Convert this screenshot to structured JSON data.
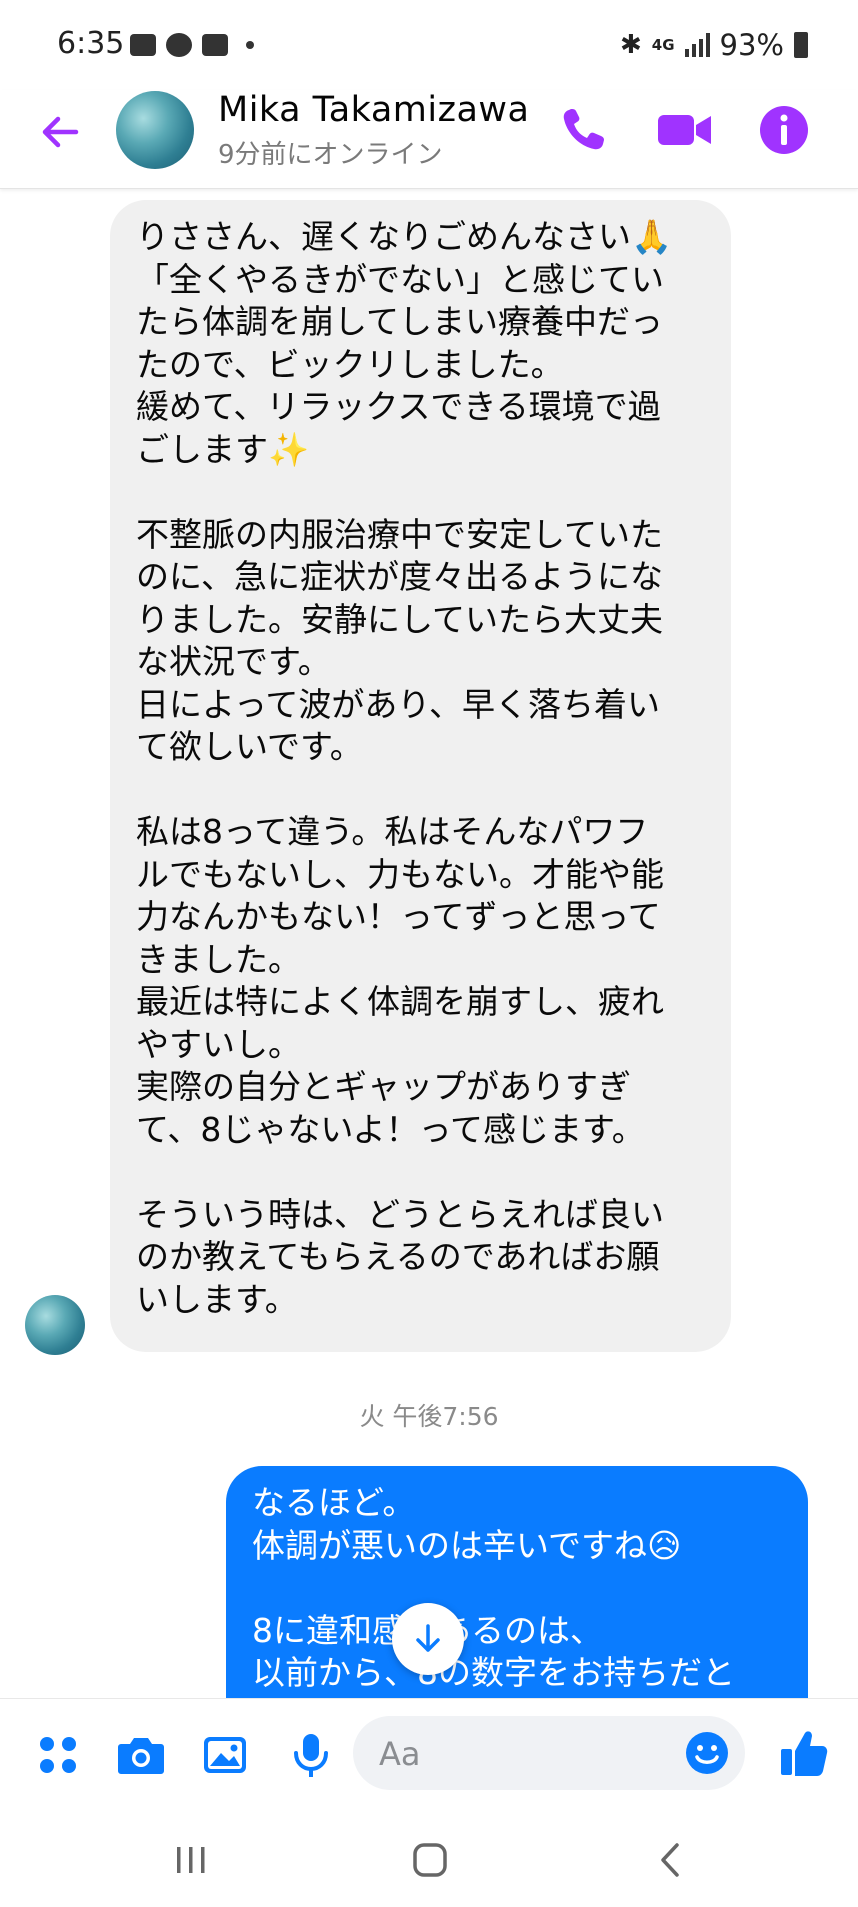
{
  "status_bar": {
    "time": "6:35",
    "battery": "93%",
    "network": "4G"
  },
  "header": {
    "contact_name": "Mika  Takamizawa",
    "contact_status": "9分前にオンライン",
    "accent_color": "#a033ff"
  },
  "messages": {
    "incoming": {
      "text": "りささん、遅くなりごめんなさい🙏\n「全くやるきがでない」と感じてい\nたら体調を崩してしまい療養中だっ\nたので、ビックリしました。\n緩めて、リラックスできる環境で過\nごします✨\n\n不整脈の内服治療中で安定していた\nのに、急に症状が度々出るようにな\nりました。安静にしていたら大丈夫\nな状況です。\n日によって波があり、早く落ち着い\nて欲しいです。\n\n私は8って違う。私はそんなパワフ\nルでもないし、力もない。才能や能\n力なんかもない！ってずっと思って\nきました。\n最近は特によく体調を崩すし、疲れ\nやすいし。\n実際の自分とギャップがありすぎ\nて、8じゃないよ！って感じます。\n\nそういう時は、どうとらえれば良い\nのか教えてもらえるのであればお願\nいします。"
    },
    "timestamp": "火 午後7:56",
    "outgoing": {
      "text": "なるほど。\n体調が悪いのは辛いですね😥\n\n8に違和感があるのは、\n以前から、8の数字をお持ちだと"
    }
  },
  "composer": {
    "placeholder": "Aa"
  },
  "icons": [
    "back-arrow-icon",
    "phone-icon",
    "video-camera-icon",
    "info-icon",
    "apps-grid-icon",
    "camera-icon",
    "gallery-icon",
    "microphone-icon",
    "emoji-icon",
    "thumbs-up-icon",
    "arrow-down-icon"
  ],
  "colors": {
    "messenger_blue": "#0a7cff",
    "incoming_bubble": "#f0f0f0",
    "header_purple": "#a033ff"
  }
}
